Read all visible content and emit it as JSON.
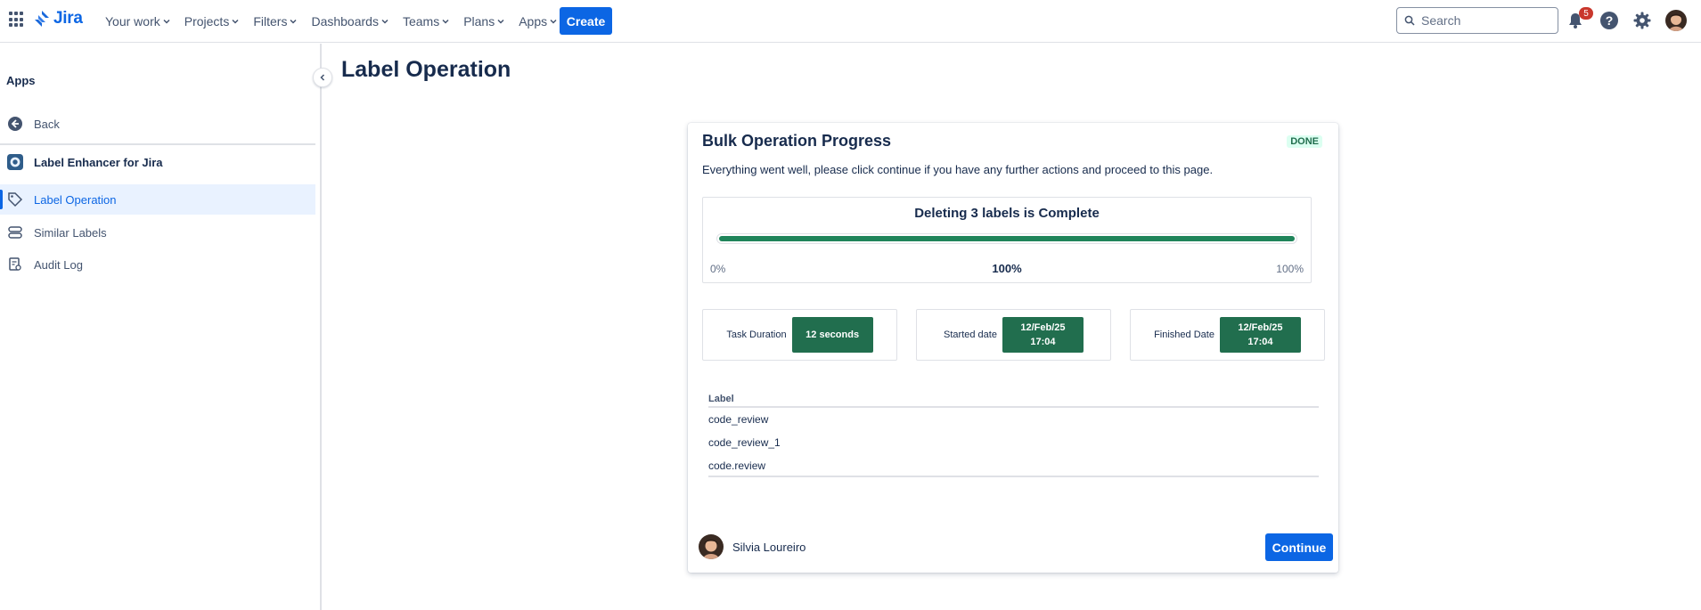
{
  "topnav": {
    "product_name": "Jira",
    "items": [
      {
        "label": "Your work"
      },
      {
        "label": "Projects"
      },
      {
        "label": "Filters"
      },
      {
        "label": "Dashboards"
      },
      {
        "label": "Teams"
      },
      {
        "label": "Plans"
      },
      {
        "label": "Apps"
      }
    ],
    "create_label": "Create",
    "search_placeholder": "Search",
    "notification_count": "5",
    "help_glyph": "?"
  },
  "sidebar": {
    "title": "Apps",
    "back_label": "Back",
    "app_name": "Label Enhancer for Jira",
    "items": [
      {
        "label": "Label Operation",
        "icon": "tag-icon",
        "selected": true
      },
      {
        "label": "Similar Labels",
        "icon": "stack-icon",
        "selected": false
      },
      {
        "label": "Audit Log",
        "icon": "audit-icon",
        "selected": false
      }
    ]
  },
  "page": {
    "title": "Label Operation"
  },
  "card": {
    "title": "Bulk Operation Progress",
    "status": "DONE",
    "description": "Everything went well, please click continue if you have any further actions and proceed to this page.",
    "progress": {
      "heading": "Deleting 3 labels is Complete",
      "min_label": "0%",
      "current_label": "100%",
      "max_label": "100%",
      "fraction": 1.0
    },
    "stats": [
      {
        "label": "Task Duration",
        "value": "12 seconds"
      },
      {
        "label": "Started date",
        "value": "12/Feb/25 17:04"
      },
      {
        "label": "Finished Date",
        "value": "12/Feb/25 17:04"
      }
    ],
    "table": {
      "header": "Label",
      "rows": [
        "code_review",
        "code_review_1",
        "code.review"
      ]
    },
    "user_name": "Silvia Loureiro",
    "continue_label": "Continue"
  },
  "colors": {
    "brand_blue": "#0c66e4",
    "success_green": "#216e4e",
    "progress_green": "#1f845a",
    "badge_red": "#c9372c"
  }
}
